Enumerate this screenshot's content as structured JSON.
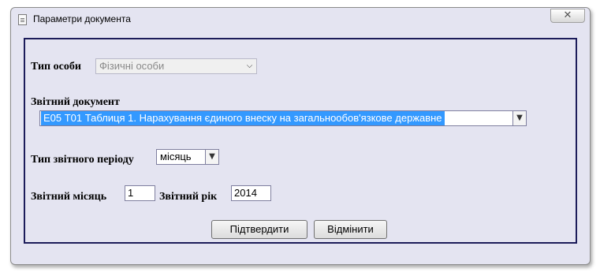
{
  "window": {
    "title": "Параметри документа",
    "close_glyph": "✕"
  },
  "form": {
    "person_type": {
      "label": "Тип особи",
      "value": "Фізичні особи",
      "disabled": true
    },
    "report_document": {
      "label": "Звітний документ",
      "value": "Е05 Т01 Таблиця 1. Нарахування єдиного внеску на загальнообов'язкове державне"
    },
    "period_type": {
      "label": "Тип звітного періоду",
      "value": "місяць"
    },
    "report_month": {
      "label": "Звітний місяць",
      "value": "1"
    },
    "report_year": {
      "label": "Звітний рік",
      "value": "2014"
    },
    "buttons": {
      "confirm": "Підтвердити",
      "cancel": "Відмінити"
    }
  },
  "icons": {
    "dropdown": "▼",
    "document": "document-icon"
  }
}
